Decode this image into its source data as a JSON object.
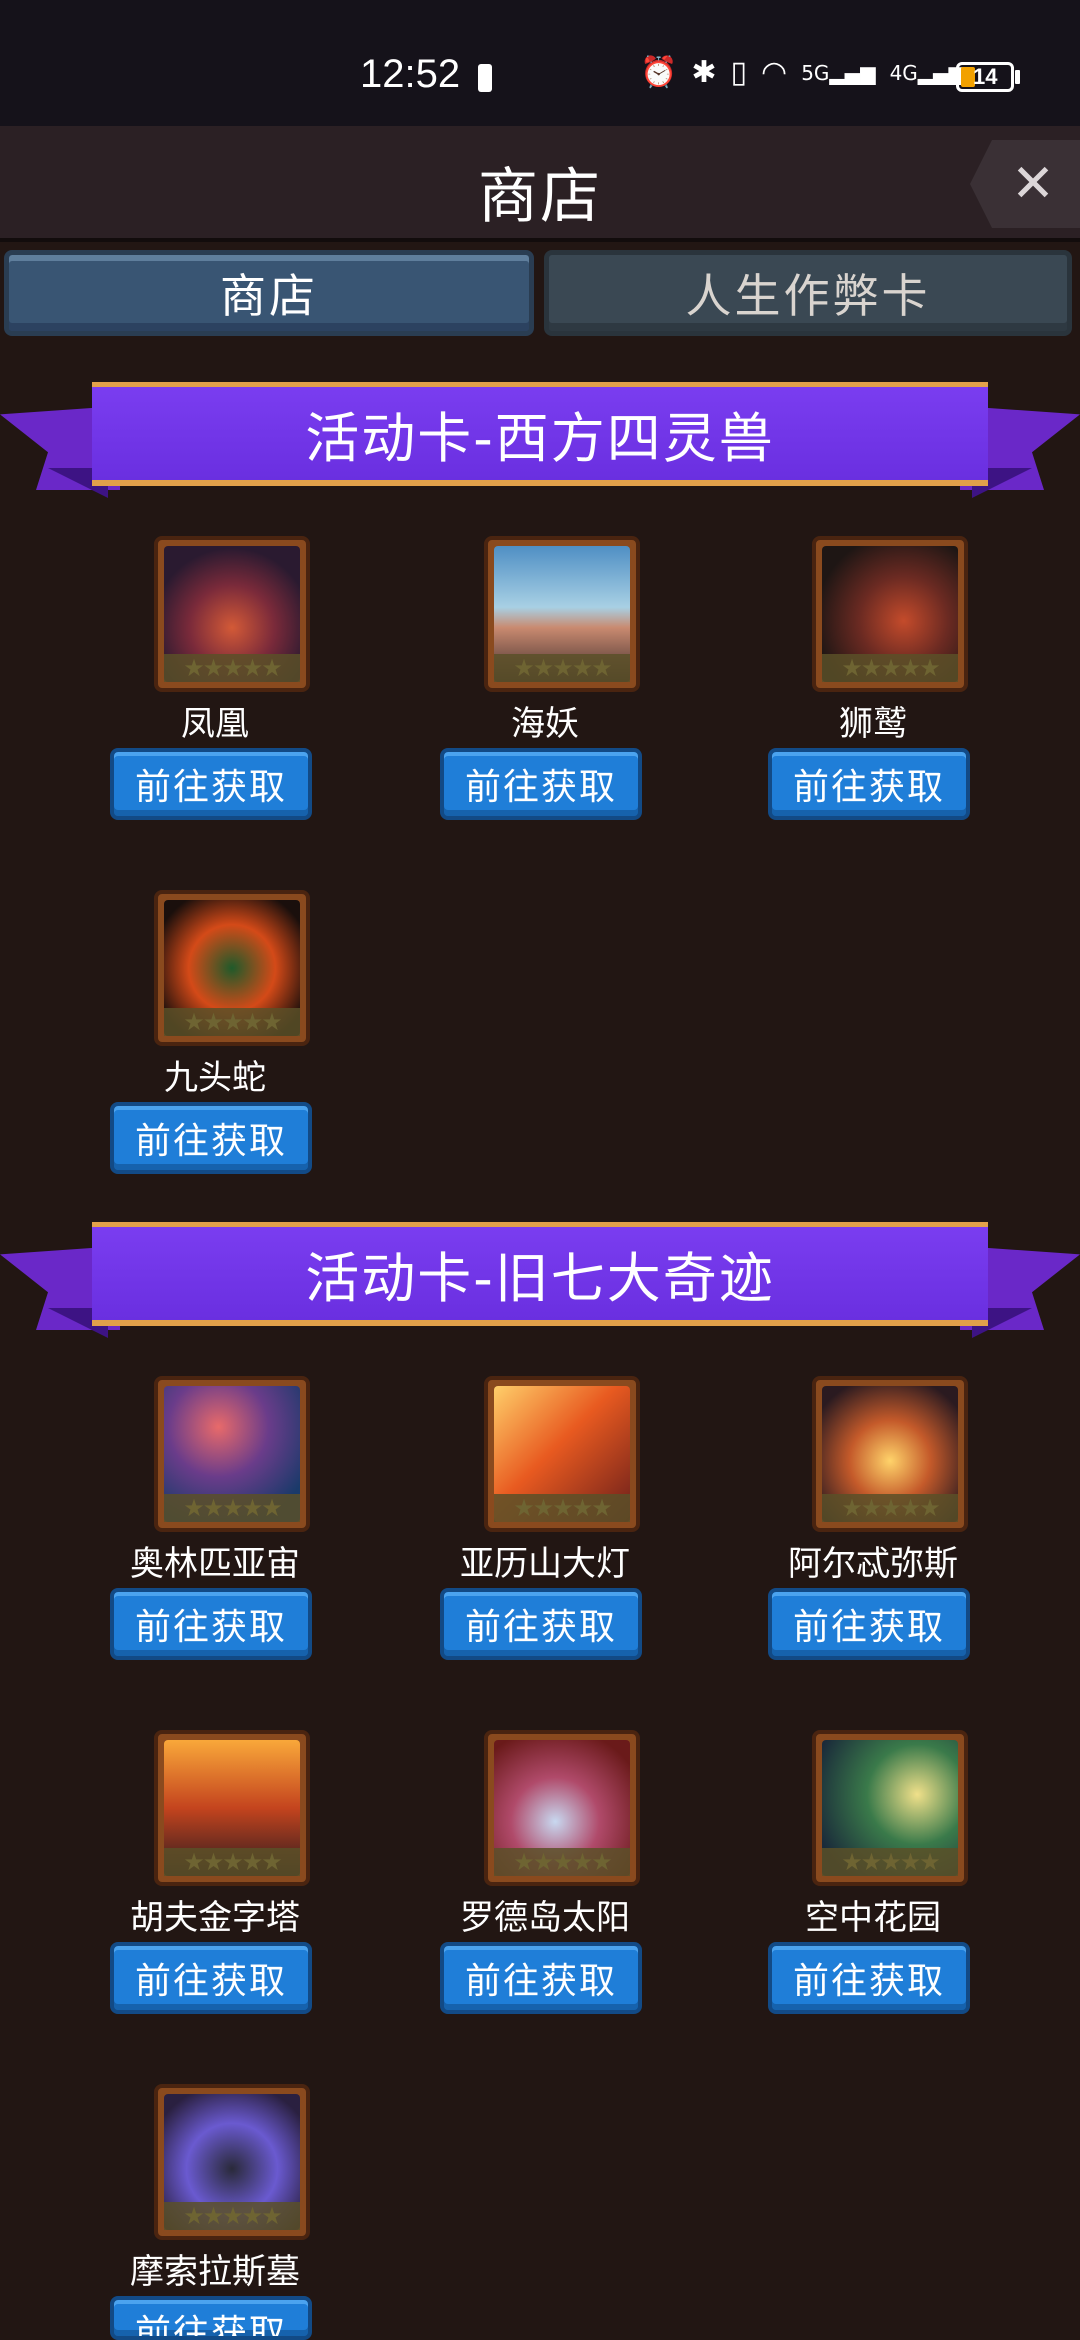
{
  "status_bar": {
    "time": "12:52",
    "battery": "14",
    "icons": [
      "alarm-icon",
      "bluetooth-icon",
      "vibrate-icon",
      "wifi-icon",
      "5g-signal-icon",
      "4g-signal-icon"
    ],
    "icon_glyphs": [
      "⏰",
      "✱",
      "▯",
      "◠",
      "5G▂▄▆",
      "4G▂▄▆"
    ]
  },
  "header": {
    "title": "商店",
    "close_glyph": "✕"
  },
  "tabs": [
    {
      "label": "商店",
      "active": true
    },
    {
      "label": "人生作弊卡",
      "active": false
    }
  ],
  "sections": [
    {
      "title": "活动卡-西方四灵兽",
      "items": [
        {
          "name": "凤凰",
          "button": "前往获取"
        },
        {
          "name": "海妖",
          "button": "前往获取"
        },
        {
          "name": "狮鹫",
          "button": "前往获取"
        },
        {
          "name": "九头蛇",
          "button": "前往获取"
        }
      ]
    },
    {
      "title": "活动卡-旧七大奇迹",
      "items": [
        {
          "name": "奥林匹亚宙",
          "button": "前往获取"
        },
        {
          "name": "亚历山大灯",
          "button": "前往获取"
        },
        {
          "name": "阿尔忒弥斯",
          "button": "前往获取"
        },
        {
          "name": "胡夫金字塔",
          "button": "前往获取"
        },
        {
          "name": "罗德岛太阳",
          "button": "前往获取"
        },
        {
          "name": "空中花园",
          "button": "前往获取"
        },
        {
          "name": "摩索拉斯墓",
          "button": "前往获取"
        }
      ]
    }
  ],
  "stars_glyph": "★★★★★",
  "colors": {
    "accent_purple": "#7a3df0",
    "button_blue": "#1f7ed8",
    "background": "#221613"
  }
}
